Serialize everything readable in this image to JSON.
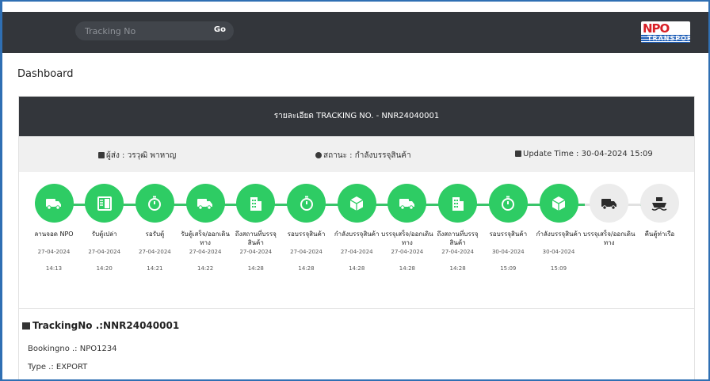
{
  "header": {
    "search_placeholder": "Tracking No",
    "go_label": "Go",
    "logo_text": "NPO",
    "logo_sub": "TRANSPORT"
  },
  "page": {
    "title": "Dashboard"
  },
  "card": {
    "title": "รายละเอียด TRACKING NO. - NNR24040001",
    "sender": "ผู้ส่ง : วรวุฒิ พาหาญ",
    "status": "สถานะ : กำลังบรรจุสินค้า",
    "update_time": "Update Time : 30-04-2024 15:09"
  },
  "steps": [
    {
      "icon": "truck-icon",
      "label": "ลานจอด NPO",
      "date": "27-04-2024",
      "time": "14:13",
      "done": true
    },
    {
      "icon": "container-icon",
      "label": "รับตู้เปล่า",
      "date": "27-04-2024",
      "time": "14:20",
      "done": true
    },
    {
      "icon": "timer-icon",
      "label": "รอรับตู้",
      "date": "27-04-2024",
      "time": "14:21",
      "done": true
    },
    {
      "icon": "truck-icon",
      "label": "รับตู้เสร็จ/ออกเดินทาง",
      "date": "27-04-2024",
      "time": "14:22",
      "done": true
    },
    {
      "icon": "building-icon",
      "label": "ถึงสถานที่บรรจุสินค้า",
      "date": "27-04-2024",
      "time": "14:28",
      "done": true
    },
    {
      "icon": "timer-icon",
      "label": "รอบรรจุสินค้า",
      "date": "27-04-2024",
      "time": "14:28",
      "done": true
    },
    {
      "icon": "box-icon",
      "label": "กำลังบรรจุสินค้า",
      "date": "27-04-2024",
      "time": "14:28",
      "done": true
    },
    {
      "icon": "truck-icon",
      "label": "บรรจุเสร็จ/ออกเดินทาง",
      "date": "27-04-2024",
      "time": "14:28",
      "done": true
    },
    {
      "icon": "building-icon",
      "label": "ถึงสถานที่บรรจุสินค้า",
      "date": "27-04-2024",
      "time": "14:28",
      "done": true
    },
    {
      "icon": "timer-icon",
      "label": "รอบรรจุสินค้า",
      "date": "30-04-2024",
      "time": "15:09",
      "done": true
    },
    {
      "icon": "box-icon",
      "label": "กำลังบรรจุสินค้า",
      "date": "30-04-2024",
      "time": "15:09",
      "done": true
    },
    {
      "icon": "truck-icon",
      "label": "บรรจุเสร็จ/ออกเดินทาง",
      "date": "",
      "time": "",
      "done": false
    },
    {
      "icon": "ship-icon",
      "label": "คืนตู้ท่าเรือ",
      "date": "",
      "time": "",
      "done": false
    }
  ],
  "details": {
    "tracking_no": "TrackingNo .:NNR24040001",
    "booking_no": "Bookingno .: NPO1234",
    "type": "Type .: EXPORT"
  },
  "colors": {
    "accent_green": "#2ecc64",
    "header_dark": "#33363b",
    "pending_gray": "#ececec"
  }
}
